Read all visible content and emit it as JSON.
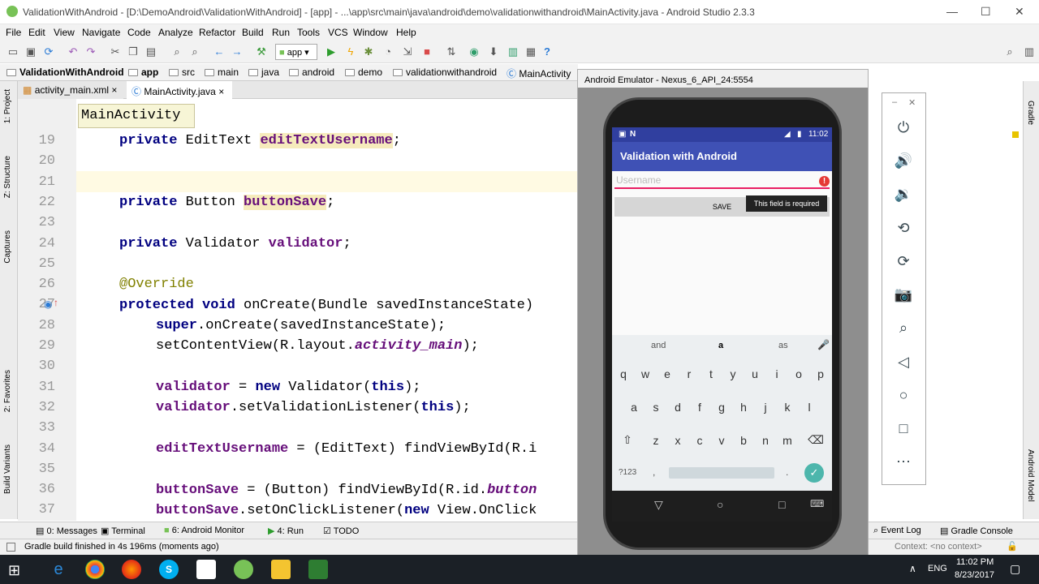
{
  "window": {
    "title": "ValidationWithAndroid - [D:\\DemoAndroid\\ValidationWithAndroid] - [app] - ...\\app\\src\\main\\java\\android\\demo\\validationwithandroid\\MainActivity.java - Android Studio 2.3.3"
  },
  "menu": [
    "File",
    "Edit",
    "View",
    "Navigate",
    "Code",
    "Analyze",
    "Refactor",
    "Build",
    "Run",
    "Tools",
    "VCS",
    "Window",
    "Help"
  ],
  "toolbar": {
    "run_config": "app"
  },
  "breadcrumbs": [
    "ValidationWithAndroid",
    "app",
    "src",
    "main",
    "java",
    "android",
    "demo",
    "validationwithandroid",
    "MainActivity"
  ],
  "tabs": [
    "activity_main.xml",
    "MainActivity.java"
  ],
  "tooltip": "MainActivity",
  "left_tools": [
    "1: Project",
    "Z: Structure",
    "Captures",
    "2: Favorites",
    "Build Variants"
  ],
  "right_tools": [
    "Gradle",
    "Android Model"
  ],
  "line_numbers": [
    "19",
    "20",
    "21",
    "22",
    "23",
    "24",
    "25",
    "26",
    "27",
    "28",
    "29",
    "30",
    "31",
    "32",
    "33",
    "34",
    "35",
    "36",
    "37"
  ],
  "bottom_tools": [
    "0: Messages",
    "Terminal",
    "6: Android Monitor",
    "4: Run",
    "TODO"
  ],
  "bottom_right_tools": [
    "Event Log",
    "Gradle Console"
  ],
  "status": {
    "message": "Gradle build finished in 4s 196ms (moments ago)",
    "context": "Context: <no context>"
  },
  "emulator": {
    "title": "Android Emulator - Nexus_6_API_24:5554",
    "time": "11:02",
    "app_title": "Validation with Android",
    "username_placeholder": "Username",
    "error_text": "This field is required",
    "save_label": "SAVE"
  },
  "keyboard": {
    "suggestions": [
      "and",
      "a",
      "as"
    ],
    "row1": [
      "q",
      "w",
      "e",
      "r",
      "t",
      "y",
      "u",
      "i",
      "o",
      "p"
    ],
    "row2": [
      "a",
      "s",
      "d",
      "f",
      "g",
      "h",
      "j",
      "k",
      "l"
    ],
    "row3": [
      "z",
      "x",
      "c",
      "v",
      "b",
      "n",
      "m"
    ],
    "symbols": "?123",
    "comma": ",",
    "period": "."
  },
  "taskbar": {
    "lang": "ENG",
    "time": "11:02 PM",
    "date": "8/23/2017"
  }
}
